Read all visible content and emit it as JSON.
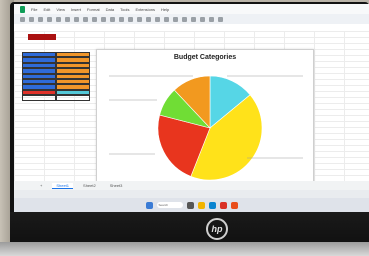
{
  "chart_data": {
    "type": "pie",
    "title": "Budget Categories",
    "slices": [
      {
        "label": "",
        "value": 14,
        "color": "#56d6e6"
      },
      {
        "label": "",
        "value": 42,
        "color": "#ffe21a"
      },
      {
        "label": "",
        "value": 23,
        "color": "#e8351e"
      },
      {
        "label": "",
        "value": 9,
        "color": "#70dd35"
      },
      {
        "label": "",
        "value": 12,
        "color": "#f2991f"
      }
    ],
    "legend": "none"
  },
  "menu": [
    "File",
    "Edit",
    "View",
    "Insert",
    "Format",
    "Data",
    "Tools",
    "Extensions",
    "Help"
  ],
  "sheet_tabs": [
    "Sheet1",
    "Sheet2",
    "Sheet3"
  ],
  "taskbar": {
    "search_placeholder": "Search"
  },
  "colors": {
    "accent": "#1a73e8",
    "sheets_green": "#0f9d58"
  }
}
